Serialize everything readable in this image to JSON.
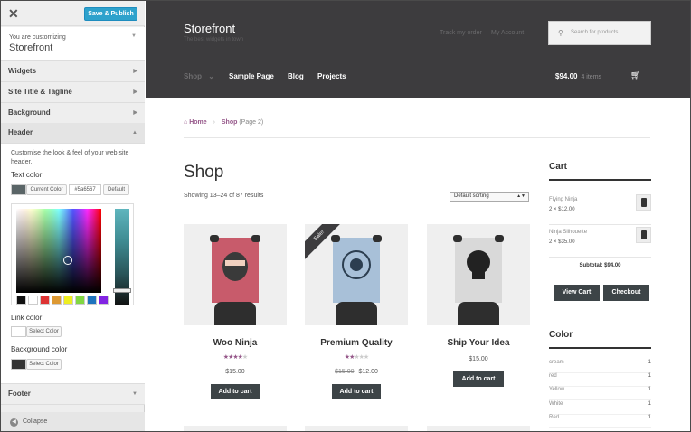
{
  "customizer": {
    "save_label": "Save & Publish",
    "customizing_label": "You are customizing",
    "site_name": "Storefront",
    "sections": [
      "Widgets",
      "Site Title & Tagline",
      "Background"
    ],
    "open_section": "Header",
    "header_description": "Customise the look & feel of your web site header.",
    "text_color_label": "Text color",
    "current_color_label": "Current Color",
    "current_color_value": "#5a6567",
    "default_label": "Default",
    "link_color_label": "Link color",
    "background_color_label": "Background color",
    "select_color_label": "Select Color",
    "footer_section": "Footer",
    "collapse_label": "Collapse",
    "palette": [
      "#111111",
      "#ffffff",
      "#dd3333",
      "#dd9933",
      "#eeee22",
      "#81d742",
      "#1e73be",
      "#8224e3"
    ],
    "colors": {
      "accent": "#2ea2cc",
      "text_swatch": "#5a6567",
      "bg_swatch": "#333333"
    }
  },
  "site": {
    "title": "Storefront",
    "tagline": "The best widgets in town",
    "top_links": [
      "Track my order",
      "My Account"
    ],
    "search_placeholder": "Search for products",
    "nav": [
      "Shop",
      "Sample Page",
      "Blog",
      "Projects"
    ],
    "cart_total": "$94.00",
    "cart_items": "4 items",
    "breadcrumb": {
      "home": "Home",
      "shop": "Shop",
      "page": "(Page 2)"
    },
    "page_title": "Shop",
    "result_count": "Showing 13–24 of 87 results",
    "sorting": "Default sorting",
    "products": [
      {
        "name": "Woo Ninja",
        "rating": 4,
        "price": "$15.00",
        "old_price": "",
        "button": "Add to cart",
        "poster_color": "#c85b6b"
      },
      {
        "name": "Premium Quality",
        "rating": 2,
        "price": "$12.00",
        "old_price": "$15.00",
        "button": "Add to cart",
        "sale": "Sale!",
        "poster_color": "#a8c0d8"
      },
      {
        "name": "Ship Your Idea",
        "rating": 0,
        "price": "$15.00",
        "old_price": "",
        "button": "Add to cart",
        "poster_color": "#d9d9d9"
      }
    ],
    "cart_widget": {
      "title": "Cart",
      "items": [
        {
          "name": "Flying Ninja",
          "qty": "2 × $12.00"
        },
        {
          "name": "Ninja Silhouette",
          "qty": "2 × $35.00"
        }
      ],
      "subtotal": "Subtotal: $94.00",
      "view_cart": "View Cart",
      "checkout": "Checkout"
    },
    "color_widget": {
      "title": "Color",
      "items": [
        {
          "name": "cream",
          "count": "1"
        },
        {
          "name": "red",
          "count": "1"
        },
        {
          "name": "Yellow",
          "count": "1"
        },
        {
          "name": "White",
          "count": "1"
        },
        {
          "name": "Red",
          "count": "1"
        }
      ]
    }
  }
}
